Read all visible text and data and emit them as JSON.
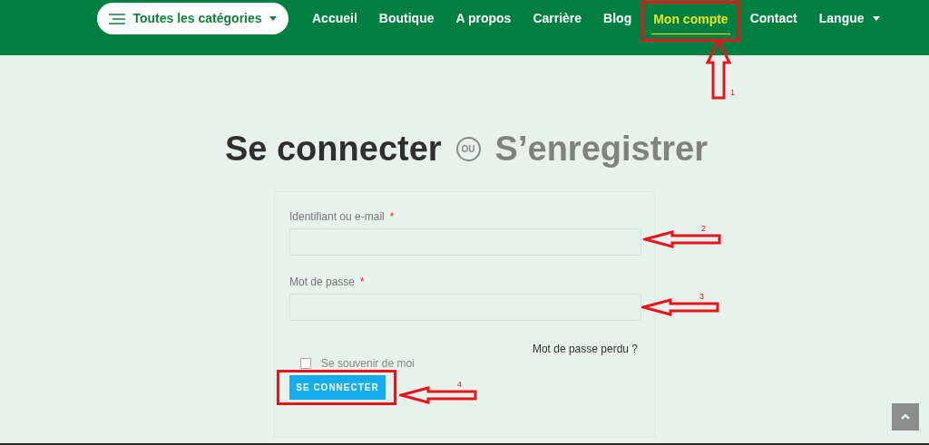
{
  "header": {
    "categories_button": "Toutes les catégories",
    "nav": [
      {
        "label": "Accueil",
        "selected": false,
        "dropdown": false
      },
      {
        "label": "Boutique",
        "selected": false,
        "dropdown": false
      },
      {
        "label": "A propos",
        "selected": false,
        "dropdown": false
      },
      {
        "label": "Carrière",
        "selected": false,
        "dropdown": false
      },
      {
        "label": "Blog",
        "selected": false,
        "dropdown": false
      },
      {
        "label": "Mon compte",
        "selected": true,
        "dropdown": false
      },
      {
        "label": "Contact",
        "selected": false,
        "dropdown": false
      },
      {
        "label": "Langue",
        "selected": false,
        "dropdown": true
      }
    ]
  },
  "heading": {
    "login": "Se connecter",
    "separator": "OU",
    "register": "S’enregistrer"
  },
  "form": {
    "fields": [
      {
        "label": "Identifiant ou e-mail",
        "required": true,
        "required_mark": "*"
      },
      {
        "label": "Mot de passe",
        "required": true,
        "required_mark": "*"
      }
    ],
    "lost_password": "Mot de passe perdu ?",
    "remember": {
      "label": "Se souvenir de moi",
      "checked": false
    },
    "submit": "SE CONNECTER"
  },
  "annotations": [
    {
      "kind": "up",
      "number": "1"
    },
    {
      "kind": "left",
      "number": "2"
    },
    {
      "kind": "left",
      "number": "3"
    },
    {
      "kind": "left",
      "number": "4"
    }
  ]
}
